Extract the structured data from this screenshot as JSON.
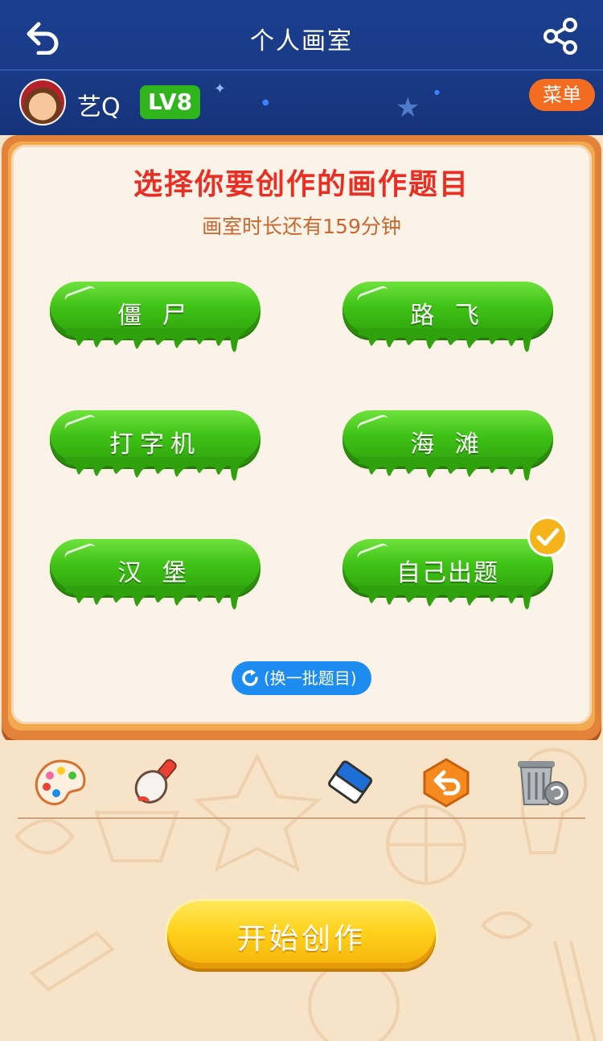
{
  "header": {
    "title": "个人画室"
  },
  "user": {
    "name": "艺Q",
    "level": "LV8"
  },
  "menu_label": "菜单",
  "panel": {
    "title": "选择你要创作的画作题目",
    "subtitle": "画室时长还有159分钟"
  },
  "topics": [
    {
      "label": "僵 尸"
    },
    {
      "label": "路 飞"
    },
    {
      "label": "打字机"
    },
    {
      "label": "海 滩"
    },
    {
      "label": "汉 堡"
    },
    {
      "label": "自己出题",
      "selected": true
    }
  ],
  "refresh_label": "(换一批题目)",
  "tools": [
    "palette-icon",
    "brush-icon",
    "eraser-icon",
    "undo-icon",
    "trash-icon"
  ],
  "start_label": "开始创作",
  "colors": {
    "header_bg": "#1a3a86",
    "title_red": "#e92f23",
    "topic_green": "#3fc216",
    "start_yellow": "#ffd21c",
    "menu_orange": "#f36d20",
    "refresh_blue": "#1d8cf0"
  }
}
